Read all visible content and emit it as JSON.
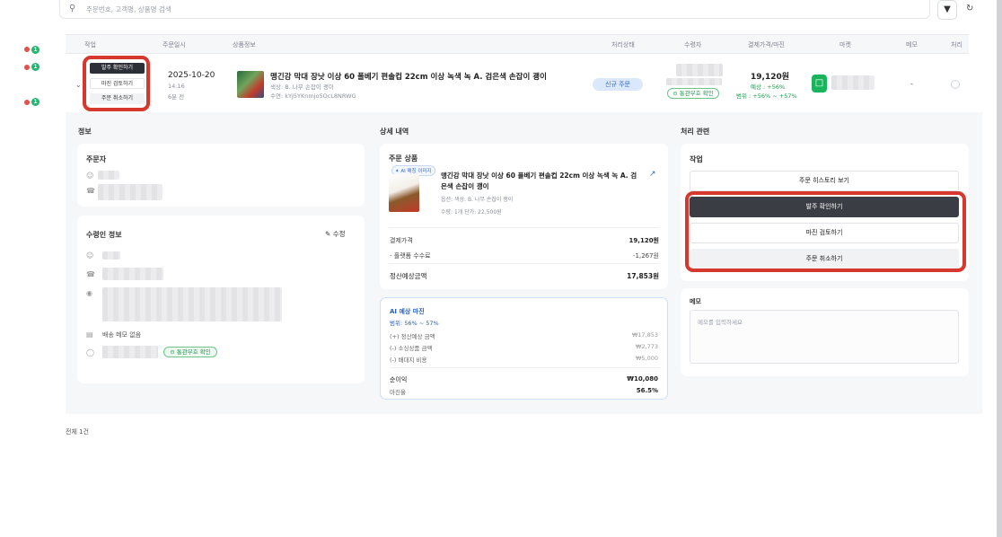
{
  "search": {
    "placeholder": "주문번호, 고객명, 상품명 검색"
  },
  "table": {
    "headers": [
      "작업",
      "주문일시",
      "상품정보",
      "처리상태",
      "수령자",
      "결제가격/마진",
      "마켓",
      "메모",
      "처리"
    ]
  },
  "nav_badges": [
    "1",
    "1",
    "1"
  ],
  "order": {
    "actions": [
      "발주 확인하기",
      "마진 검토하기",
      "주문 취소하기"
    ],
    "date": "2025-10-20",
    "time": "14:16",
    "ago": "6분 전",
    "product_name": "맹긴강 막대 장낫 이상 60 폴베기 편솔컵 22cm 이상 녹색 녹 A. 검은색 손잡이 괭이",
    "option": "색상: B. 나무 손잡이 괭이",
    "code": "수연: kYJ5YKnmjo5OcL8NRWG",
    "status": "신규 주문",
    "customs_badge": "통관부호 확인",
    "price": "19,120원",
    "margin_line1": "예상 : +56%",
    "margin_line2": "범위 : +56% ~ +57%",
    "memo": "-"
  },
  "info": {
    "section_title": "정보",
    "orderer_title": "주문자",
    "receiver_title": "수령인 정보",
    "edit_label": "수정",
    "delivery_memo": "배송 메모 없음",
    "customs_badge": "통관부호 확인"
  },
  "detail": {
    "section_title": "상세 내역",
    "card_title": "주문 상품",
    "ai_tag": "AI 매칭 이미지",
    "product_name_l1": "맹긴강 막대 장낫 이상 60 폴베기 편솔컵 22cm 이상 녹색 녹 A. 검",
    "product_name_l2": "은색 손잡이 괭이",
    "option": "옵션: 색상: B. 나무 손잡이 괭이",
    "qty_price": "수량: 1개   단가: 22,500원",
    "rows": [
      {
        "label": "결제가격",
        "value": "19,120원"
      },
      {
        "label": "- 플랫폼 수수료",
        "value": "-1,267원"
      },
      {
        "label": "정산예상금액",
        "value": "17,853원"
      }
    ]
  },
  "ai_margin": {
    "title": "AI 예상 마진",
    "range": "범위: 56% ~ 57%",
    "rows": [
      {
        "label": "(+) 정산예상 금액",
        "value": "₩17,853"
      },
      {
        "label": "(-) 소싱상품 금액",
        "value": "₩2,773"
      },
      {
        "label": "(-) 배대지 비용",
        "value": "₩5,000"
      }
    ],
    "profit_label": "순이익",
    "profit_value": "₩10,080",
    "margin_label": "마진율",
    "margin_value": "56.5%"
  },
  "process": {
    "section_title": "처리 관련",
    "card_title": "작업",
    "history_button": "주문 히스토리 보기",
    "confirm_button": "발주 확인하기",
    "review_button": "마진 검토하기",
    "cancel_button": "주문 취소하기",
    "memo_title": "메모",
    "memo_placeholder": "메모를 입력하세요"
  },
  "footer": {
    "total": "전체 1건"
  },
  "colors": {
    "accent_red": "#d7382d",
    "green": "#1f9a54",
    "dark_button": "#3b3d44",
    "status_blue": "#dbe8fb"
  }
}
